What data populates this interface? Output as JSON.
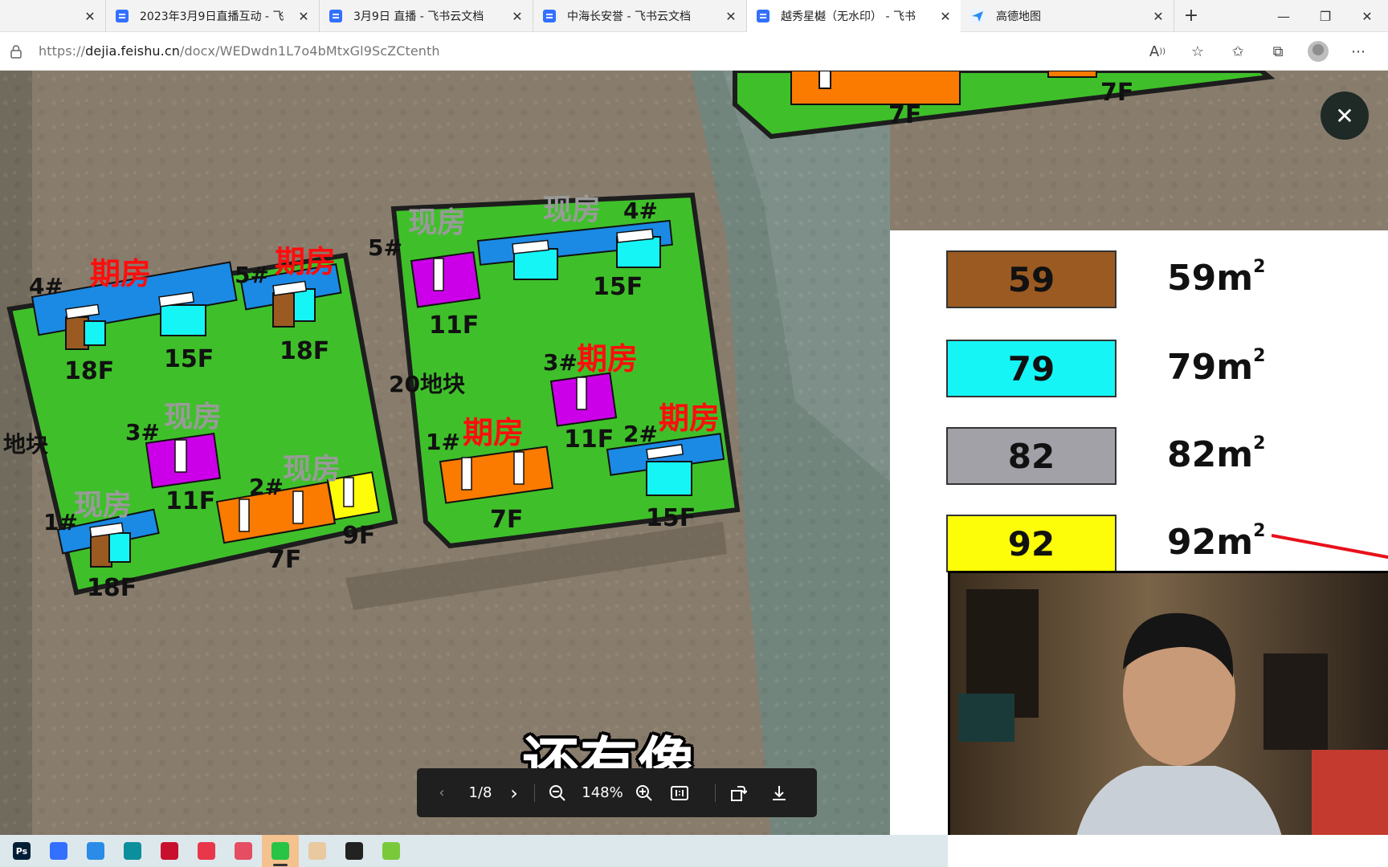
{
  "browser": {
    "tabs": [
      {
        "title": "",
        "icon": "blank"
      },
      {
        "title": "2023年3月9日直播互动 - 飞",
        "icon": "feishu-doc-icon"
      },
      {
        "title": "3月9日 直播 - 飞书云文档",
        "icon": "feishu-doc-icon"
      },
      {
        "title": "中海长安誉 - 飞书云文档",
        "icon": "feishu-doc-icon"
      },
      {
        "title": "越秀星樾（无水印） - 飞书",
        "icon": "feishu-doc-icon",
        "active": true
      },
      {
        "title": "高德地图",
        "icon": "amap-icon"
      }
    ],
    "new_tab": "+",
    "url_prefix": "https://",
    "url_host": "dejia.feishu.cn",
    "url_path": "/docx/WEDwdn1L7o4bMtxGl9ScZCtenth"
  },
  "site_plan": {
    "labels": [
      {
        "text": "4#",
        "type": "num"
      },
      {
        "text": "期房",
        "type": "red"
      },
      {
        "text": "5#",
        "type": "num"
      },
      {
        "text": "期房",
        "type": "red"
      },
      {
        "text": "18F",
        "type": "floor"
      },
      {
        "text": "15F",
        "type": "floor"
      },
      {
        "text": "18F",
        "type": "floor"
      },
      {
        "text": "地块",
        "type": "num"
      },
      {
        "text": "3#",
        "type": "num"
      },
      {
        "text": "现房",
        "type": "gray"
      },
      {
        "text": "11F",
        "type": "floor"
      },
      {
        "text": "现房",
        "type": "gray"
      },
      {
        "text": "1#",
        "type": "num"
      },
      {
        "text": "18F",
        "type": "floor"
      },
      {
        "text": "现房",
        "type": "gray"
      },
      {
        "text": "2#",
        "type": "num"
      },
      {
        "text": "7F",
        "type": "floor"
      },
      {
        "text": "9F",
        "type": "floor"
      },
      {
        "text": "现房",
        "type": "gray"
      },
      {
        "text": "5#",
        "type": "num"
      },
      {
        "text": "11F",
        "type": "floor"
      },
      {
        "text": "现房",
        "type": "gray"
      },
      {
        "text": "4#",
        "type": "num"
      },
      {
        "text": "15F",
        "type": "floor"
      },
      {
        "text": "20地块",
        "type": "num"
      },
      {
        "text": "3#",
        "type": "num"
      },
      {
        "text": "期房",
        "type": "red"
      },
      {
        "text": "11F",
        "type": "floor"
      },
      {
        "text": "1#",
        "type": "num"
      },
      {
        "text": "期房",
        "type": "red"
      },
      {
        "text": "7F",
        "type": "floor"
      },
      {
        "text": "2#",
        "type": "num"
      },
      {
        "text": "期房",
        "type": "red"
      },
      {
        "text": "15F",
        "type": "floor"
      },
      {
        "text": "7F",
        "type": "floor"
      },
      {
        "text": "7F",
        "type": "floor"
      }
    ]
  },
  "legend": {
    "items": [
      {
        "code": "59",
        "area": "59m",
        "sup": "2",
        "color": "#9b5a22"
      },
      {
        "code": "79",
        "area": "79m",
        "sup": "2",
        "color": "#16f5f5"
      },
      {
        "code": "82",
        "area": "82m",
        "sup": "2",
        "color": "#a2a1a8"
      },
      {
        "code": "92",
        "area": "92m",
        "sup": "2",
        "color": "#fdfd0a"
      }
    ]
  },
  "viewer": {
    "page": "1/8",
    "zoom": "148%",
    "subtitle": "还有像"
  },
  "taskbar": {
    "apps": [
      {
        "name": "photoshop-icon",
        "label": "Ps",
        "color": "#001e36"
      },
      {
        "name": "feishu-icon",
        "label": "",
        "color": "#3370ff"
      },
      {
        "name": "app-blue-icon",
        "label": "",
        "color": "#2a8ce6"
      },
      {
        "name": "edge-icon",
        "label": "",
        "color": "#0c8f9c"
      },
      {
        "name": "pdf-icon",
        "label": "",
        "color": "#c8102e"
      },
      {
        "name": "record-icon",
        "label": "",
        "color": "#e8364b"
      },
      {
        "name": "photo-icon",
        "label": "",
        "color": "#e54d63"
      },
      {
        "name": "wechat-icon",
        "label": "",
        "color": "#28c445",
        "active": true
      },
      {
        "name": "butterfly-icon",
        "label": "",
        "color": "#e8c9a0"
      },
      {
        "name": "obs-icon",
        "label": "",
        "color": "#222222"
      },
      {
        "name": "maps-icon",
        "label": "",
        "color": "#7ac93b"
      }
    ]
  }
}
